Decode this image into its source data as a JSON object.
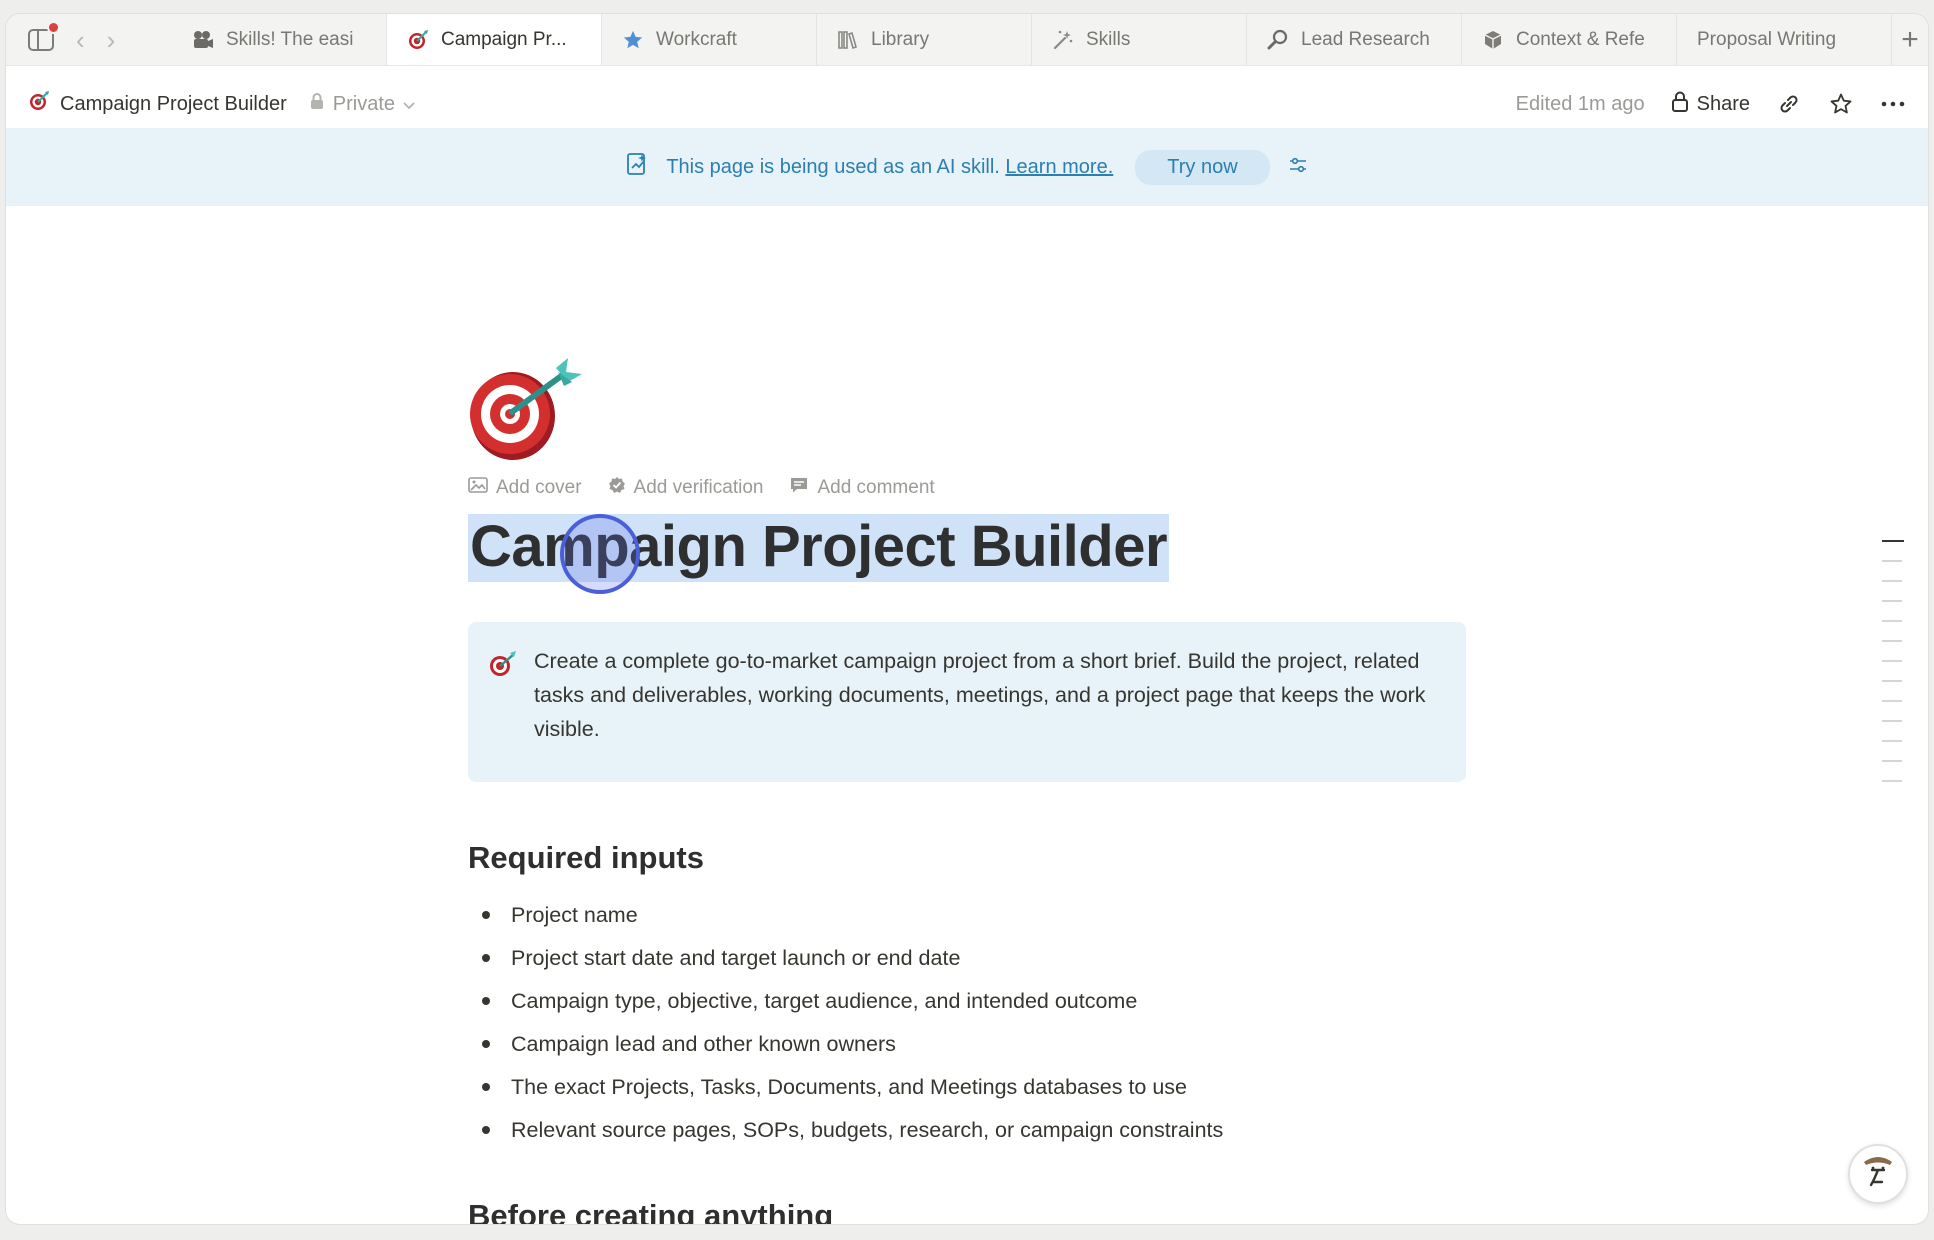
{
  "tabs": [
    {
      "label": "Skills! The easi",
      "icon": "video-camera-icon",
      "active": false
    },
    {
      "label": "Campaign Pr...",
      "icon": "target-icon",
      "active": true
    },
    {
      "label": "Workcraft",
      "icon": "star-icon",
      "active": false
    },
    {
      "label": "Library",
      "icon": "books-icon",
      "active": false
    },
    {
      "label": "Skills",
      "icon": "magic-wand-icon",
      "active": false
    },
    {
      "label": "Lead Research",
      "icon": "magnifier-icon",
      "active": false
    },
    {
      "label": "Context & Refe",
      "icon": "cube-icon",
      "active": false
    },
    {
      "label": "Proposal Writing",
      "icon": "",
      "active": false
    }
  ],
  "topbar": {
    "page_name": "Campaign Project Builder",
    "privacy": "Private",
    "edited": "Edited 1m ago",
    "share_label": "Share"
  },
  "banner": {
    "text": "This page is being used as an AI skill.",
    "learn_more": "Learn more.",
    "try_now": "Try now"
  },
  "page": {
    "actions": {
      "add_cover": "Add cover",
      "add_verification": "Add verification",
      "add_comment": "Add comment"
    },
    "title": "Campaign Project Builder",
    "callout": "Create a complete go-to-market campaign project from a short brief. Build the project, related tasks and deliverables, working documents, meetings, and a project page that keeps the work visible.",
    "required_inputs_heading": "Required inputs",
    "required_inputs": [
      "Project name",
      "Project start date and target launch or end date",
      "Campaign type, objective, target audience, and intended outcome",
      "Campaign lead and other known owners",
      "The exact Projects, Tasks, Documents, and Meetings databases to use",
      "Relevant source pages, SOPs, budgets, research, or campaign constraints"
    ],
    "next_heading": "Before creating anything"
  },
  "colors": {
    "banner_bg": "#e7f3f8",
    "banner_text": "#2c7fb0",
    "selection": "#cfe2f7",
    "cursor_ring": "#4a5fd8",
    "notification": "#e03e3e"
  }
}
